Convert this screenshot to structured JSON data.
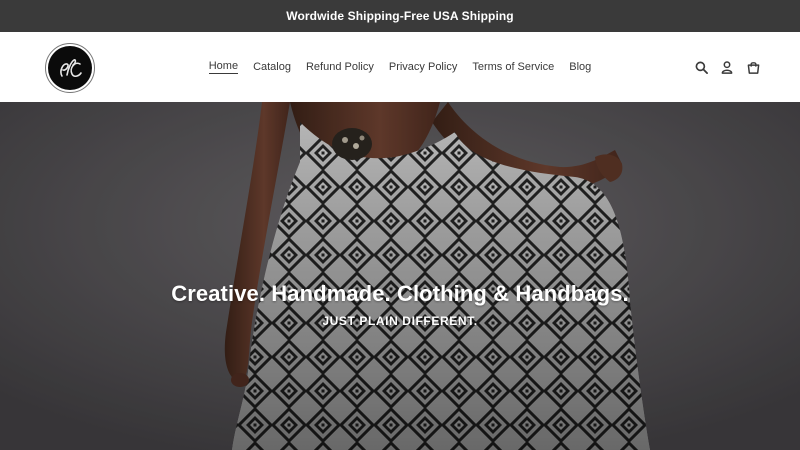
{
  "announcement": {
    "text": "Wordwide Shipping-Free USA Shipping"
  },
  "header": {
    "logo_icon": "brand-monogram-logo",
    "nav": [
      {
        "label": "Home",
        "active": true
      },
      {
        "label": "Catalog",
        "active": false
      },
      {
        "label": "Refund Policy",
        "active": false
      },
      {
        "label": "Privacy Policy",
        "active": false
      },
      {
        "label": "Terms of Service",
        "active": false
      },
      {
        "label": "Blog",
        "active": false
      }
    ],
    "icons": [
      "search-icon",
      "account-icon",
      "cart-icon"
    ]
  },
  "hero": {
    "title": "Creative. Handmade. Clothing & Handbags.",
    "subtitle": "JUST PLAIN DIFFERENT.",
    "image": "model-in-patterned-dress"
  },
  "colors": {
    "announcement_bg": "#3a3a3a",
    "text": "#3a3a3a",
    "hero_bg": "#545255",
    "hero_text": "#ffffff"
  }
}
